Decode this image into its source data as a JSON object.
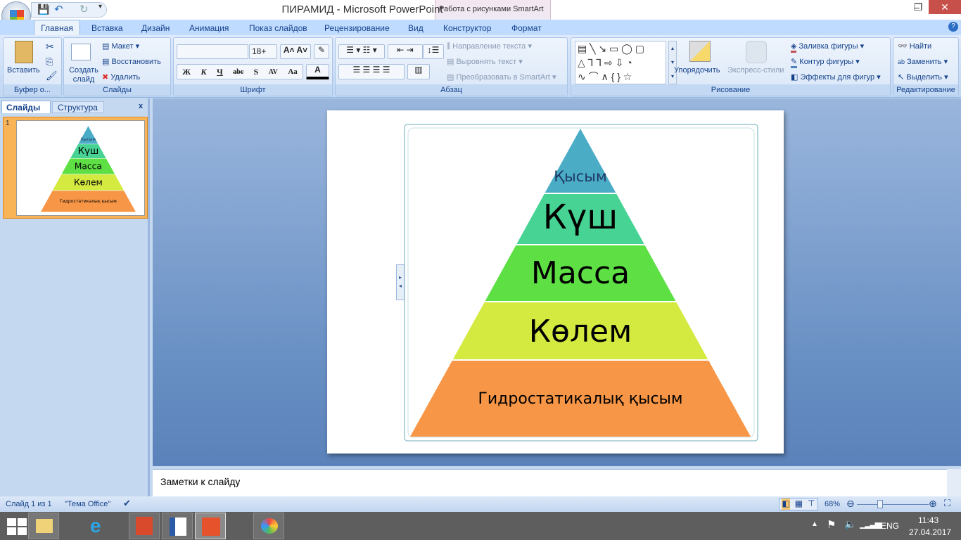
{
  "window": {
    "title": "ПИРАМИД - Microsoft PowerPoint",
    "context_tab_group": "Работа с рисунками SmartArt",
    "minimize": "‒",
    "restore": "❐",
    "close": "✕"
  },
  "tabs": [
    "Главная",
    "Вставка",
    "Дизайн",
    "Анимация",
    "Показ слайдов",
    "Рецензирование",
    "Вид",
    "Конструктор",
    "Формат"
  ],
  "ribbon": {
    "clipboard": {
      "label": "Буфер о...",
      "paste": "Вставить"
    },
    "slides": {
      "label": "Слайды",
      "new_slide": "Создать слайд",
      "layout": "Макет",
      "reset": "Восстановить",
      "delete": "Удалить"
    },
    "font": {
      "label": "Шрифт",
      "font_name": "",
      "font_size": "18+",
      "bold": "Ж",
      "italic": "К",
      "underline": "Ч",
      "strike": "abc",
      "shadow": "S",
      "spacing": "AV",
      "case": "Aa",
      "color": "A"
    },
    "paragraph": {
      "label": "Абзац",
      "text_direction": "Направление текста",
      "align_text": "Выровнять текст",
      "convert": "Преобразовать в SmartArt"
    },
    "drawing": {
      "label": "Рисование",
      "arrange": "Упорядочить",
      "quick_styles": "Экспресс-стили",
      "fill": "Заливка фигуры",
      "outline": "Контур фигуры",
      "effects": "Эффекты для фигур"
    },
    "editing": {
      "label": "Редактирование",
      "find": "Найти",
      "replace": "Заменить",
      "select": "Выделить"
    }
  },
  "left_pane": {
    "tabs": [
      "Слайды",
      "Структура"
    ],
    "close": "x",
    "slide_number": "1"
  },
  "pyramid": {
    "levels": [
      "Қысым",
      "Күш",
      "Масса",
      "Көлем",
      "Гидростатикалық қысым"
    ],
    "colors": [
      "#4bacc6",
      "#47d394",
      "#5ee045",
      "#d4ea40",
      "#f79646"
    ]
  },
  "notes": {
    "placeholder": "Заметки к слайду"
  },
  "status": {
    "slide": "Слайд 1 из 1",
    "theme": "\"Тема Office\"",
    "zoom": "68%",
    "zoom_level": 68
  },
  "taskbar": {
    "lang": "ENG",
    "time": "11:43",
    "date": "27.04.2017"
  }
}
